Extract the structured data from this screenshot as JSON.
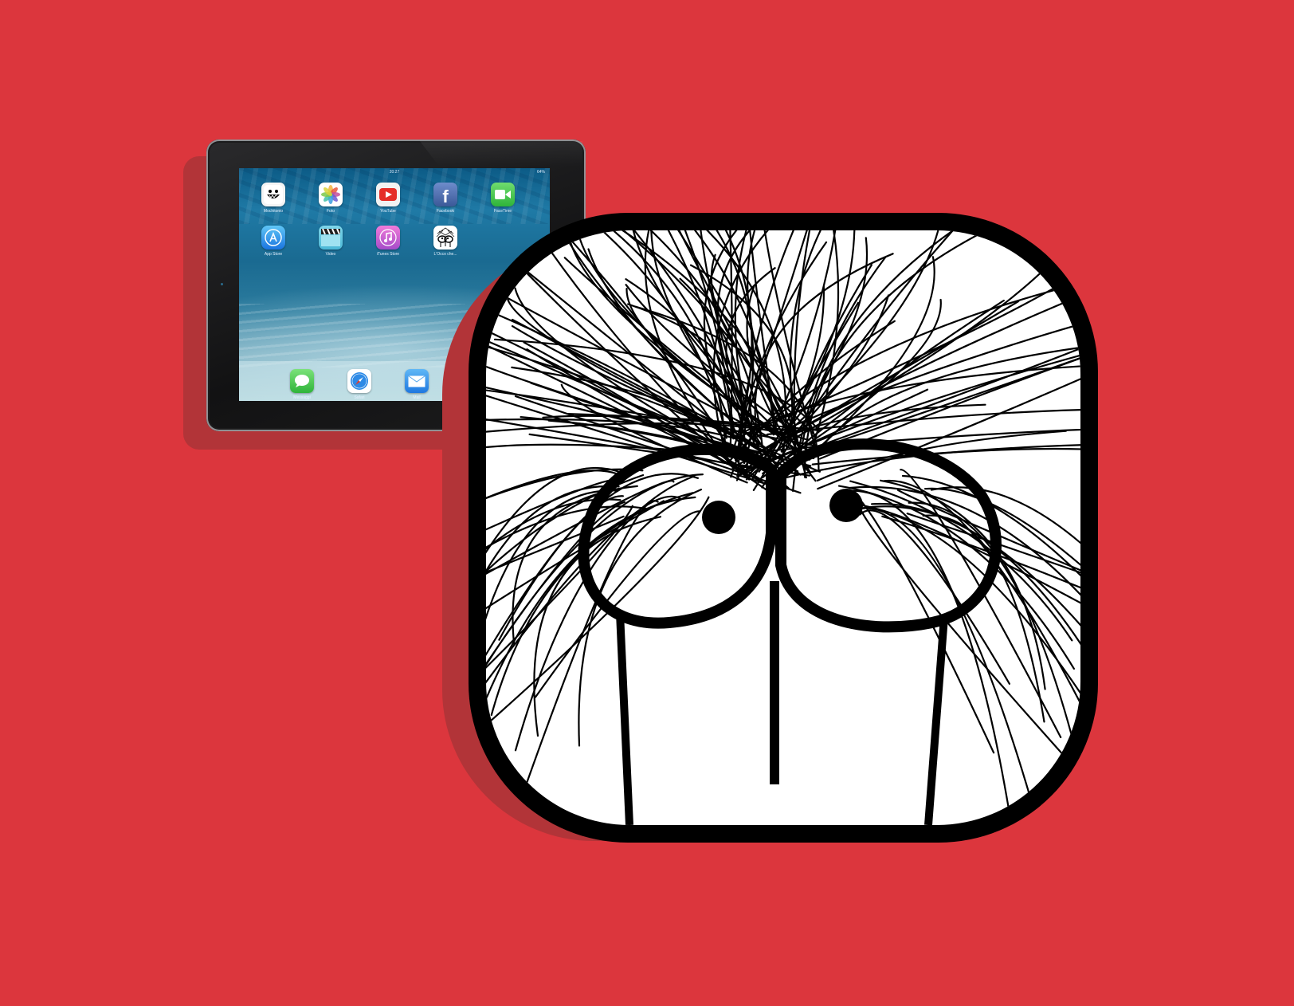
{
  "ipad": {
    "status_time": "20:27",
    "status_battery": "64%",
    "apps": [
      {
        "label": "Mochitonio",
        "icon": "smiley-face-icon"
      },
      {
        "label": "Foto",
        "icon": "photos-flower-icon"
      },
      {
        "label": "YouTube",
        "icon": "youtube-play-icon"
      },
      {
        "label": "Facebook",
        "icon": "facebook-f-icon"
      },
      {
        "label": "FaceTime",
        "icon": "video-camera-icon"
      },
      {
        "label": "App Store",
        "icon": "app-store-a-icon"
      },
      {
        "label": "Video",
        "icon": "clapperboard-icon"
      },
      {
        "label": "iTunes Store",
        "icon": "music-note-icon"
      },
      {
        "label": "L'Occo che...",
        "icon": "bug-eyed-creature-icon"
      }
    ],
    "dock": [
      {
        "label": "Messaggi",
        "icon": "speech-bubble-icon"
      },
      {
        "label": "Safari",
        "icon": "compass-icon"
      },
      {
        "label": "Mail",
        "icon": "envelope-icon"
      }
    ]
  },
  "big_icon": {
    "icon": "bug-eyed-creature-icon"
  },
  "colors": {
    "background": "#dc363d",
    "shadow": "#b23438",
    "bezel": "#161617"
  }
}
